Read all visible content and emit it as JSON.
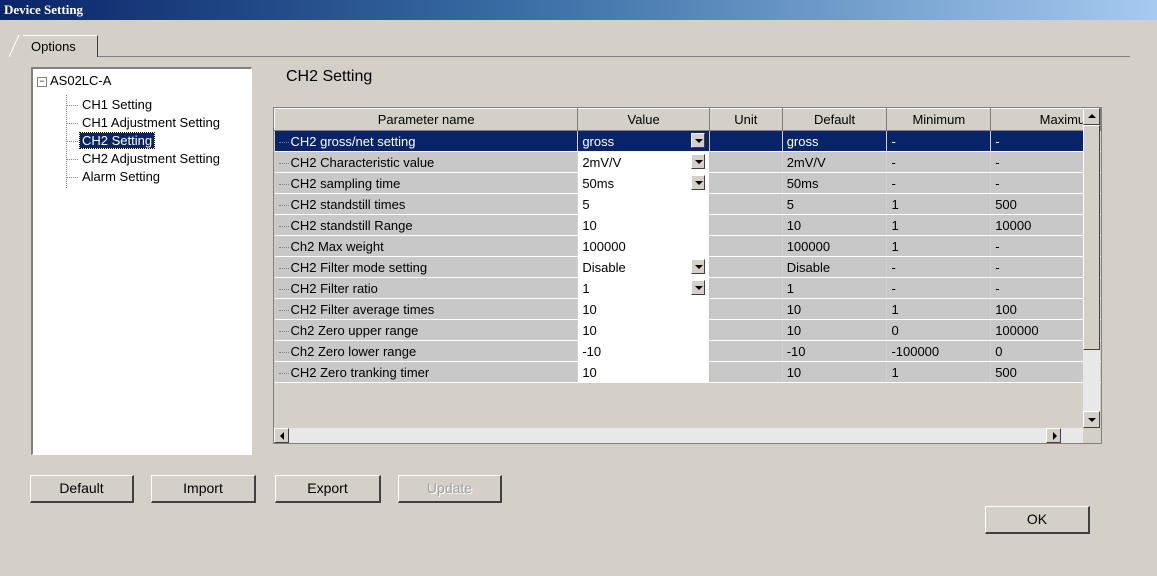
{
  "window": {
    "title": "Device Setting"
  },
  "tabs": [
    {
      "label": "Options"
    }
  ],
  "tree": {
    "root": "AS02LC-A",
    "expander": "⊟",
    "items": [
      {
        "label": "CH1 Setting"
      },
      {
        "label": "CH1 Adjustment Setting"
      },
      {
        "label": "CH2 Setting",
        "selected": true
      },
      {
        "label": "CH2 Adjustment Setting"
      },
      {
        "label": "Alarm Setting"
      }
    ]
  },
  "main": {
    "title": "CH2 Setting"
  },
  "grid": {
    "columns": [
      "Parameter name",
      "Value",
      "Unit",
      "Default",
      "Minimum",
      "Maximum"
    ],
    "rows": [
      {
        "name": "CH2 gross/net setting",
        "value": "gross",
        "dropdown": true,
        "unit": "",
        "default": "gross",
        "min": "-",
        "max": "-",
        "selected": true
      },
      {
        "name": "CH2 Characteristic value",
        "value": "2mV/V",
        "dropdown": true,
        "unit": "",
        "default": "2mV/V",
        "min": "-",
        "max": "-"
      },
      {
        "name": "CH2 sampling time",
        "value": "50ms",
        "dropdown": true,
        "unit": "",
        "default": "50ms",
        "min": "-",
        "max": "-"
      },
      {
        "name": "CH2 standstill times",
        "value": "5",
        "dropdown": false,
        "unit": "",
        "default": "5",
        "min": "1",
        "max": "500"
      },
      {
        "name": "CH2 standstill Range",
        "value": "10",
        "dropdown": false,
        "unit": "",
        "default": "10",
        "min": "1",
        "max": "10000"
      },
      {
        "name": "Ch2 Max weight",
        "value": "100000",
        "dropdown": false,
        "unit": "",
        "default": "100000",
        "min": "1",
        "max": "-"
      },
      {
        "name": "CH2 Filter mode setting",
        "value": "Disable",
        "dropdown": true,
        "unit": "",
        "default": "Disable",
        "min": "-",
        "max": "-"
      },
      {
        "name": "CH2 Filter ratio",
        "value": "1",
        "dropdown": true,
        "unit": "",
        "default": "1",
        "min": "-",
        "max": "-"
      },
      {
        "name": "CH2 Filter average times",
        "value": "10",
        "dropdown": false,
        "unit": "",
        "default": "10",
        "min": "1",
        "max": "100"
      },
      {
        "name": "Ch2 Zero upper range",
        "value": "10",
        "dropdown": false,
        "unit": "",
        "default": "10",
        "min": "0",
        "max": "100000"
      },
      {
        "name": "Ch2 Zero lower range",
        "value": "-10",
        "dropdown": false,
        "unit": "",
        "default": "-10",
        "min": "-100000",
        "max": "0"
      },
      {
        "name": "CH2 Zero tranking timer",
        "value": "10",
        "dropdown": false,
        "unit": "",
        "default": "10",
        "min": "1",
        "max": "500"
      }
    ]
  },
  "buttons": {
    "default": "Default",
    "import": "Import",
    "export": "Export",
    "update": "Update",
    "ok": "OK"
  },
  "colors": {
    "selection": "#0a246a",
    "face": "#d4d0c8"
  }
}
